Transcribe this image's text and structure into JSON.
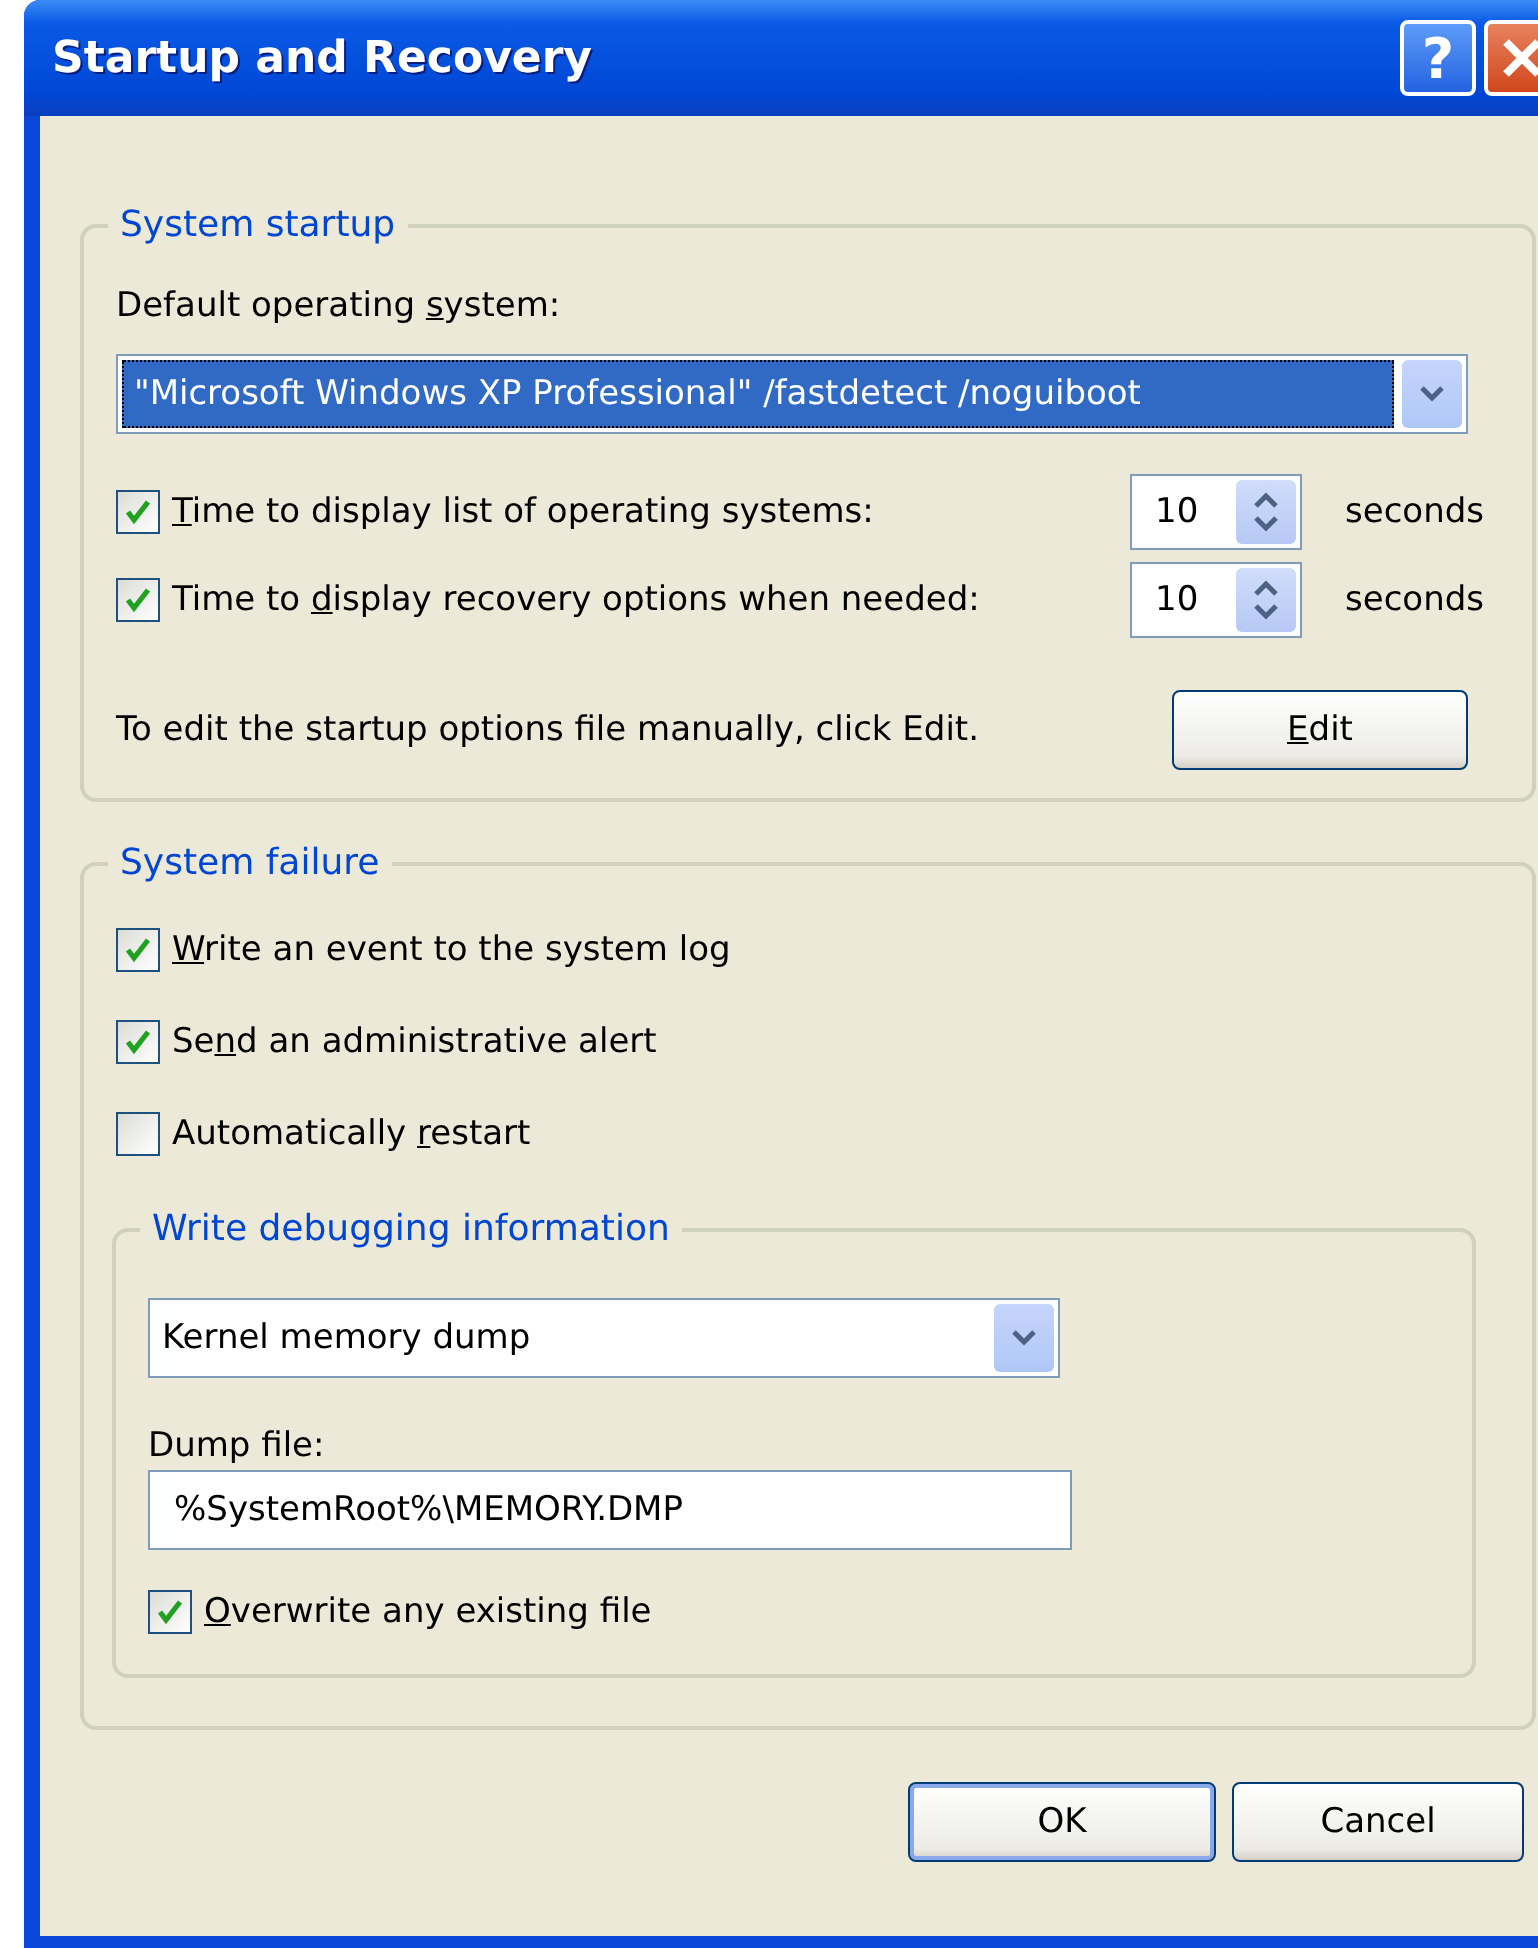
{
  "window": {
    "title": "Startup and Recovery",
    "help": "?",
    "close": true
  },
  "system_startup": {
    "title": "System startup",
    "default_os_label": {
      "pre": "Default operating ",
      "key": "s",
      "post": "ystem:"
    },
    "default_os": {
      "value": "\"Microsoft Windows XP Professional\" /fastdetect /noguiboot",
      "focused": true
    },
    "timeouts": [
      {
        "label": {
          "key": "T",
          "post": "ime to display list of operating systems:"
        },
        "checked": true,
        "value": "10",
        "unit": "seconds"
      },
      {
        "label": {
          "pre": "Time to ",
          "key": "d",
          "post": "isplay recovery options when needed:"
        },
        "checked": true,
        "value": "10",
        "unit": "seconds"
      }
    ],
    "edit_hint": "To edit the startup options file manually, click Edit.",
    "edit_button": {
      "key": "E",
      "post": "dit"
    }
  },
  "system_failure": {
    "title": "System failure",
    "options": [
      {
        "label": {
          "key": "W",
          "post": "rite an event to the system log"
        },
        "checked": true
      },
      {
        "label": {
          "pre": "Se",
          "key": "n",
          "post": "d an administrative alert"
        },
        "checked": true
      },
      {
        "label": {
          "pre": "Automatically ",
          "key": "r",
          "post": "estart"
        },
        "checked": false
      }
    ],
    "debug": {
      "title": "Write debugging information",
      "dump_type": "Kernel memory dump",
      "dump_file_label": "Dump file:",
      "dump_file": "%SystemRoot%\\MEMORY.DMP",
      "overwrite": {
        "label": {
          "key": "O",
          "post": "verwrite any existing file"
        },
        "checked": true
      }
    }
  },
  "buttons": [
    {
      "label": "OK",
      "default": true
    },
    {
      "label": "Cancel",
      "default": false
    }
  ]
}
